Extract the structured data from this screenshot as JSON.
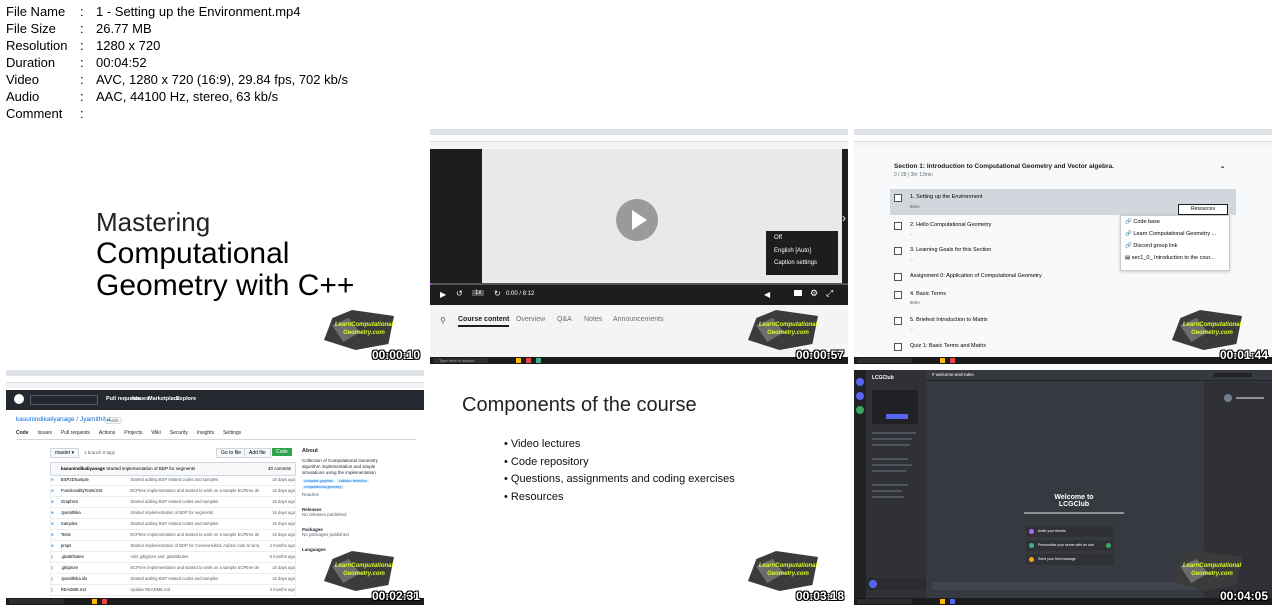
{
  "meta": [
    {
      "key": "File Name",
      "value": "1 - Setting up the Environment.mp4"
    },
    {
      "key": "File Size",
      "value": "26.77 MB"
    },
    {
      "key": "Resolution",
      "value": "1280 x 720"
    },
    {
      "key": "Duration",
      "value": "00:04:52"
    },
    {
      "key": "Video",
      "value": "AVC, 1280 x 720 (16:9), 29.84 fps, 702 kb/s"
    },
    {
      "key": "Audio",
      "value": "AAC, 44100 Hz, stereo, 63 kb/s"
    },
    {
      "key": "Comment",
      "value": ""
    }
  ],
  "meta_sep": ":",
  "logo_text": "LearnComputational Geometry.com",
  "thumbs": {
    "t1": {
      "time": "00:00:10",
      "line1": "Mastering",
      "line2": "Computational",
      "line3": "Geometry with C++"
    },
    "t2": {
      "time": "00:00:57",
      "caption_menu": [
        "Off",
        "English [Auto]",
        "Caption settings"
      ],
      "video_time": "0:00 / 8:12",
      "speed": "1x",
      "tabs": [
        "Course content",
        "Overview",
        "Q&A",
        "Notes",
        "Announcements"
      ],
      "taskbar_search": "Type here to search"
    },
    "t3": {
      "time": "00:01:44",
      "section_title": "Section 1: Introduction to Computational Geometry and Vector algebra.",
      "section_meta": "0 / 28 | 3hr 13min",
      "items": [
        {
          "title": "1. Setting up the Environment",
          "sub": "5min"
        },
        {
          "title": "2. Hello Computational Geometry",
          "sub": "..."
        },
        {
          "title": "3. Learning Goals for this Section",
          "sub": "..."
        },
        {
          "title": "Assignment 0: Application of Computational Geometry",
          "sub": ""
        },
        {
          "title": "4. Basic Terms",
          "sub": "8min"
        },
        {
          "title": "5. Briefest Introduction to Matrix",
          "sub": "..."
        },
        {
          "title": "Quiz 1: Basic Terms and Matrix",
          "sub": ""
        }
      ],
      "resources_label": "Resources",
      "resources_menu": [
        "Code base",
        "Learn Computational Geometry ...",
        "Discord group link",
        "sec1_0_ Introduction to the cour..."
      ]
    },
    "t4": {
      "time": "00:02:31",
      "repo": "kasunindikaliyanage / Jyamithika",
      "visibility": "Public",
      "nav": [
        "Pull requests",
        "Issues",
        "Marketplace",
        "Explore"
      ],
      "tabs": [
        "Code",
        "Issues",
        "Pull requests",
        "Actions",
        "Projects",
        "Wiki",
        "Security",
        "Insights",
        "Settings"
      ],
      "branch": "master",
      "branch_meta": "1 branch   0 tags",
      "goto": "Go to file",
      "addfile": "Add file",
      "code_btn": "Code",
      "commit_author": "kasunindikaliyanage",
      "commit_msg": "Started implementation of BDP for segments",
      "commit_count": "40 commits",
      "files": [
        {
          "name": "BSP2DSample",
          "msg": "Started adding BSP related codes and samples",
          "age": "16 days ago"
        },
        {
          "name": "FunctionalityTests/Jmt",
          "msg": "ECPtree implementation and started to work on a sample ECPtree demons...",
          "age": "16 days ago"
        },
        {
          "name": "GraphIcs",
          "msg": "Started adding BSP related codes and samples",
          "age": "16 days ago"
        },
        {
          "name": "Jyamithika",
          "msg": "Started implementation of BDP for segments",
          "age": "16 days ago"
        },
        {
          "name": "Samples",
          "msg": "Started adding BSP related codes and samples",
          "age": "16 days ago"
        },
        {
          "name": "Tests",
          "msg": "ECPtree implementation and started to work on a sample ECPtree demons...",
          "age": "16 days ago"
        },
        {
          "name": "props",
          "msg": "Started implementation of BDP for ConvexHull2d. Added code to simp...",
          "age": "2 months ago"
        },
        {
          "name": ".gitattributes",
          "msg": "Add .gitignore and .gitattributes",
          "age": "5 months ago"
        },
        {
          "name": ".gitignore",
          "msg": "ECPtree implementation and started to work on a sample ECPtree demons...",
          "age": "16 days ago"
        },
        {
          "name": "Jyamithika.sln",
          "msg": "Started adding BSP related codes and samples",
          "age": "16 days ago"
        },
        {
          "name": "README.md",
          "msg": "Update README.md",
          "age": "3 months ago"
        }
      ],
      "about_title": "About",
      "about_text": "Collection of Computational Geometry algorithm implementation and simple simulations using the implementation",
      "topics": [
        "computer-graphics",
        "collision-detection",
        "computational-geometry"
      ],
      "readme": "Readme",
      "releases": "Releases",
      "releases_text": "No releases published",
      "packages": "Packages",
      "packages_text": "No packages published",
      "languages": "Languages"
    },
    "t5": {
      "time": "00:03:18",
      "title": "Components of the course",
      "items": [
        "Video lectures",
        "Code repository",
        "Questions, assignments and coding exercises",
        "Resources"
      ]
    },
    "t6": {
      "time": "00:04:05",
      "server": "LCGClub",
      "channel": "welcome-and-rules",
      "welcome_title": "Welcome to",
      "welcome_name": "LCGClub",
      "actions": [
        "Invite your friends",
        "Personalize your server with an icon",
        "Send your first message"
      ]
    }
  }
}
